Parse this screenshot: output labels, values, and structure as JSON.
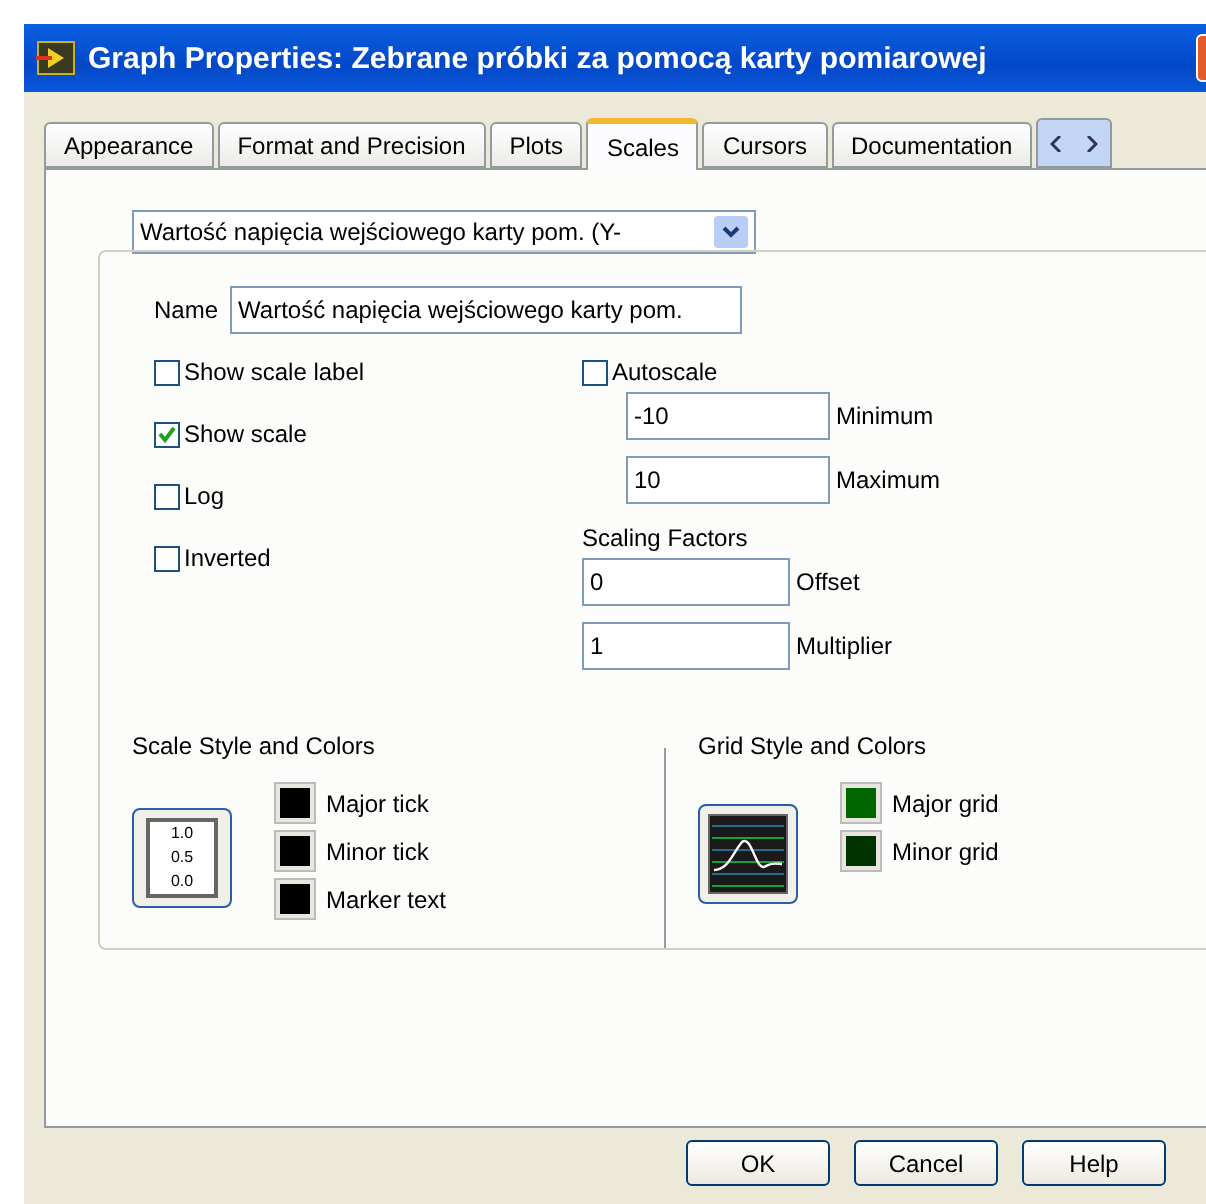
{
  "window": {
    "title": "Graph Properties: Zebrane próbki za pomocą karty pomiarowej"
  },
  "tabs": [
    {
      "label": "Appearance",
      "selected": false
    },
    {
      "label": "Format and Precision",
      "selected": false
    },
    {
      "label": "Plots",
      "selected": false
    },
    {
      "label": "Scales",
      "selected": true
    },
    {
      "label": "Cursors",
      "selected": false
    },
    {
      "label": "Documentation",
      "selected": false
    }
  ],
  "scales": {
    "axis_select": "Wartość napięcia wejściowego karty pom. (Y-",
    "name_label": "Name",
    "name_value": "Wartość napięcia wejściowego karty pom.",
    "options": [
      {
        "label": "Show scale label",
        "checked": false
      },
      {
        "label": "Show scale",
        "checked": true
      },
      {
        "label": "Log",
        "checked": false
      },
      {
        "label": "Inverted",
        "checked": false
      }
    ],
    "autoscale": {
      "label": "Autoscale",
      "checked": false
    },
    "range_fields": [
      {
        "value": "-10",
        "label": "Minimum"
      },
      {
        "value": "10",
        "label": "Maximum"
      }
    ],
    "scaling_factors": {
      "title": "Scaling Factors",
      "fields": [
        {
          "value": "0",
          "label": "Offset"
        },
        {
          "value": "1",
          "label": "Multiplier"
        }
      ]
    },
    "scale_style": {
      "title": "Scale Style and Colors",
      "sample_ticks": [
        "1.0",
        "0.5",
        "0.0"
      ],
      "colors": [
        {
          "label": "Major tick",
          "color": "#000000"
        },
        {
          "label": "Minor tick",
          "color": "#000000"
        },
        {
          "label": "Marker text",
          "color": "#000000"
        }
      ]
    },
    "grid_style": {
      "title": "Grid Style and Colors",
      "colors": [
        {
          "label": "Major grid",
          "color": "#006600"
        },
        {
          "label": "Minor grid",
          "color": "#003300"
        }
      ]
    }
  },
  "buttons": [
    "OK",
    "Cancel",
    "Help"
  ]
}
